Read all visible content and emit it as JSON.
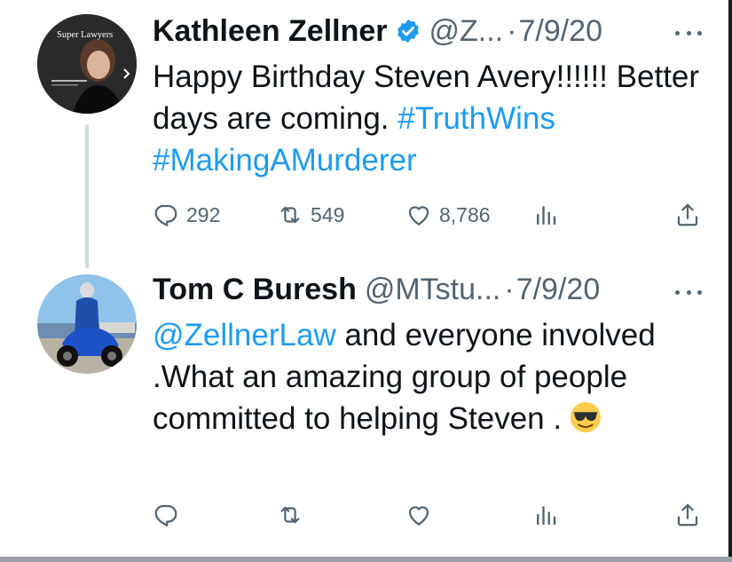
{
  "tweets": [
    {
      "name": "Kathleen Zellner",
      "handle": "@Z...",
      "separator": "·",
      "date": "7/9/20",
      "avatar_text": "Super Lawyers",
      "text_main": "Happy Birthday Steven Avery!!!!!! Better days are coming. ",
      "hashtag_1": "#TruthWins",
      "hashtag_2": "#MakingAMurderer",
      "reply_count": "292",
      "retweet_count": "549",
      "like_count": "8,786"
    },
    {
      "name": "Tom C Buresh",
      "handle": "@MTstu...",
      "separator": "·",
      "date": "7/9/20",
      "mention": "@ZellnerLaw",
      "text_main": " and everyone involved .What an amazing group of people committed to helping Steven .",
      "emoji": "sunglasses-emoji"
    }
  ],
  "colors": {
    "link": "#1d9bf0",
    "muted": "#536471",
    "text": "#0f1419",
    "thread_line": "#cfd9de"
  }
}
